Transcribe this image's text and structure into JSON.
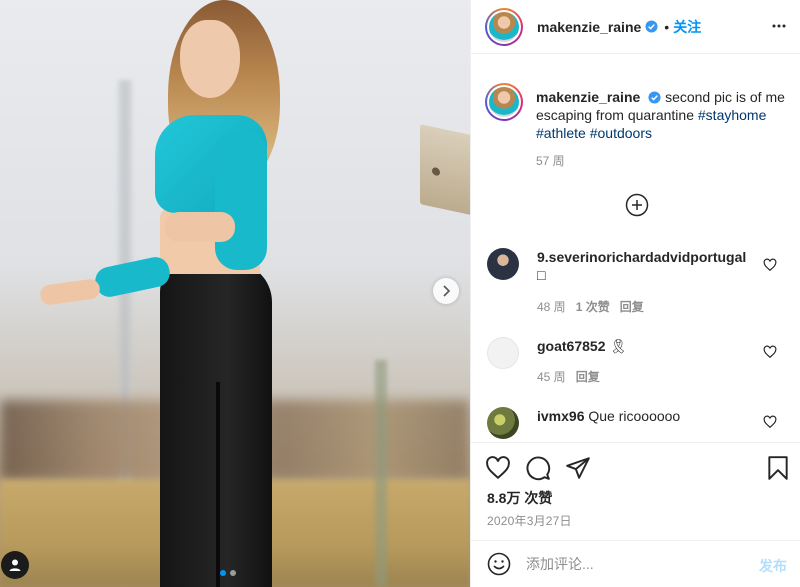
{
  "post": {
    "username": "makenzie_raine",
    "follow_separator": "•",
    "follow_label": "关注",
    "caption_text": "second pic is of me escaping from quarantine",
    "hashtags": [
      "#stayhome",
      "#athlete",
      "#outdoors"
    ],
    "caption_time": "57 周"
  },
  "comments": [
    {
      "username": "9.severinorichardadvidportugal",
      "text": "□",
      "time": "48 周",
      "likes": "1 次赞",
      "reply": "回复",
      "avatar_color": "#2b3244"
    },
    {
      "username": "goat67852",
      "text": "🎗",
      "time": "45 周",
      "reply": "回复",
      "avatar_color": "#f2f2f2"
    },
    {
      "username": "ivmx96",
      "text": "Que ricoooooo",
      "avatar_color": "#6f7a3e"
    }
  ],
  "actions": {
    "likes": "8.8万 次赞",
    "date": "2020年3月27日"
  },
  "add_comment": {
    "placeholder": "添加评论...",
    "post_label": "发布"
  },
  "icons": [
    "more-options-icon",
    "verified-badge-icon",
    "load-more-comments-icon",
    "heart-icon",
    "comment-icon",
    "share-icon",
    "save-bookmark-icon",
    "emoji-icon",
    "next-photo-icon",
    "user-tag-icon"
  ],
  "colors": {
    "link_blue": "#0095f6",
    "hashtag": "#00376b",
    "muted": "#8e8e8e",
    "post_disabled": "#b2dffc"
  },
  "carousel": {
    "slides": 2,
    "active": 1
  }
}
